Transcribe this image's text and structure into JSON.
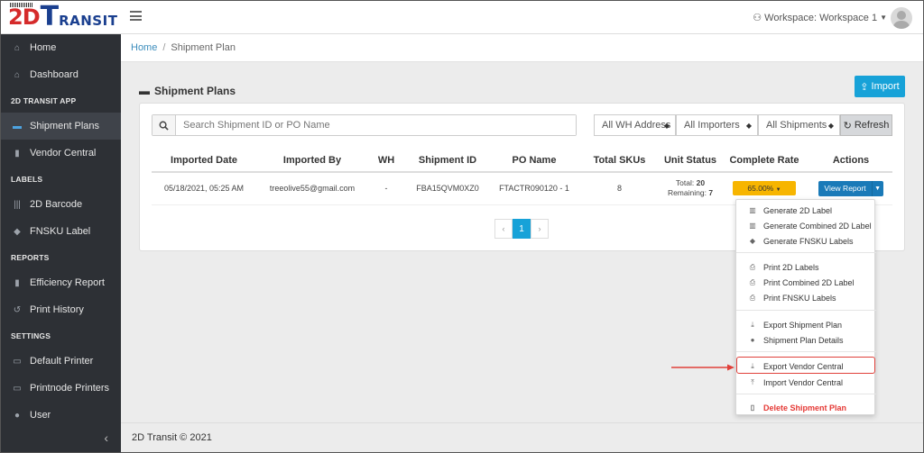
{
  "brand": {
    "part1": "2D",
    "part2": "T",
    "part3": "RANSIT"
  },
  "topbar": {
    "workspace_label": "Workspace: Workspace 1"
  },
  "sidebar": {
    "items": [
      {
        "label": "Home",
        "icon": "home-icon",
        "glyph": "⌂"
      },
      {
        "label": "Dashboard",
        "icon": "dashboard-icon",
        "glyph": "⌂"
      }
    ],
    "section_app": "2D TRANSIT APP",
    "app_items": [
      {
        "label": "Shipment Plans",
        "icon": "truck-icon",
        "glyph": "▬"
      },
      {
        "label": "Vendor Central",
        "icon": "bar-chart-icon",
        "glyph": "▮"
      }
    ],
    "section_labels": "LABELS",
    "label_items": [
      {
        "label": "2D Barcode",
        "icon": "barcode-icon",
        "glyph": "|||"
      },
      {
        "label": "FNSKU Label",
        "icon": "tag-icon",
        "glyph": "◆"
      }
    ],
    "section_reports": "REPORTS",
    "report_items": [
      {
        "label": "Efficiency Report",
        "icon": "chart-icon",
        "glyph": "▮"
      },
      {
        "label": "Print History",
        "icon": "history-icon",
        "glyph": "↺"
      }
    ],
    "section_settings": "SETTINGS",
    "setting_items": [
      {
        "label": "Default Printer",
        "icon": "printer-icon",
        "glyph": "▭"
      },
      {
        "label": "Printnode Printers",
        "icon": "printer-icon",
        "glyph": "▭"
      },
      {
        "label": "User",
        "icon": "user-icon",
        "glyph": "●"
      }
    ]
  },
  "breadcrumb": {
    "home": "Home",
    "separator": "/",
    "current": "Shipment Plan"
  },
  "page": {
    "title": "Shipment Plans",
    "import_label": "Import"
  },
  "filters": {
    "search_placeholder": "Search Shipment ID or PO Name",
    "wh": "All WH Address",
    "importers": "All Importers",
    "shipments": "All Shipments",
    "refresh_label": "Refresh"
  },
  "table": {
    "headers": [
      "Imported Date",
      "Imported By",
      "WH",
      "Shipment ID",
      "PO Name",
      "Total SKUs",
      "Unit Status",
      "Complete Rate",
      "Actions"
    ],
    "rows": [
      {
        "date": "05/18/2021, 05:25 AM",
        "by": "treeolive55@gmail.com",
        "wh": "-",
        "shipment_id": "FBA15QVM0XZ0",
        "po_name": "FTACTR090120 - 1",
        "total_skus": "8",
        "total_label": "Total:",
        "total_value": "20",
        "remaining_label": "Remaining:",
        "remaining_value": "7",
        "rate": "65.00%",
        "action": "View Report"
      }
    ]
  },
  "pagination": {
    "prev": "‹",
    "current": "1",
    "next": "›"
  },
  "dropdown": {
    "items": [
      {
        "label": "Generate 2D Label",
        "icon": "barcode-icon"
      },
      {
        "label": "Generate Combined 2D Label",
        "icon": "barcode-icon"
      },
      {
        "label": "Generate FNSKU Labels",
        "icon": "tags-icon"
      },
      {
        "label": "Print 2D Labels",
        "icon": "printer-icon"
      },
      {
        "label": "Print Combined 2D Label",
        "icon": "printer-icon"
      },
      {
        "label": "Print FNSKU Labels",
        "icon": "printer-icon"
      },
      {
        "label": "Export Shipment Plan",
        "icon": "download-icon"
      },
      {
        "label": "Shipment Plan Details",
        "icon": "info-icon"
      },
      {
        "label": "Export Vendor Central",
        "icon": "download-icon"
      },
      {
        "label": "Import Vendor Central",
        "icon": "upload-icon"
      },
      {
        "label": "Delete Shipment Plan",
        "icon": "trash-icon"
      }
    ]
  },
  "footer": {
    "text": "2D Transit © 2021"
  },
  "colors": {
    "accent": "#17a2d8",
    "sidebar": "#2d3035",
    "rate": "#f7b500",
    "danger": "#e53935",
    "action": "#1a7ab8"
  }
}
